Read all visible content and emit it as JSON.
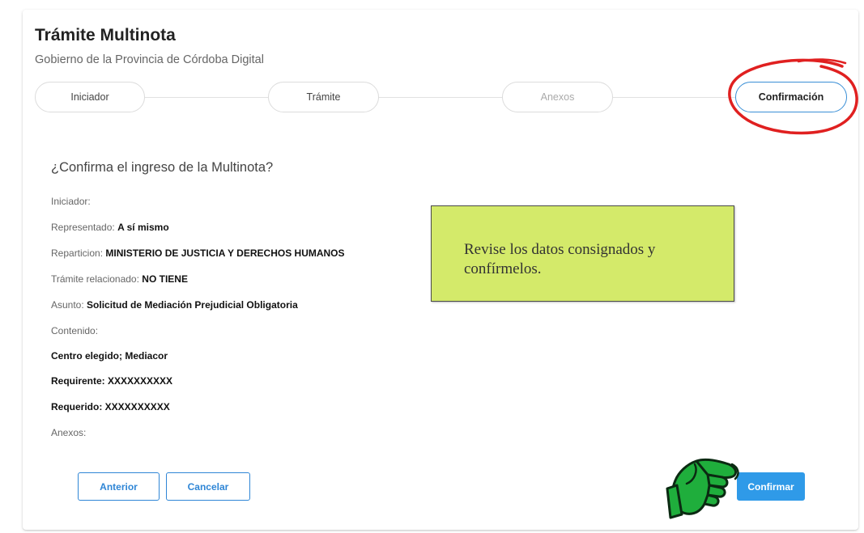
{
  "header": {
    "title": "Trámite Multinota",
    "subtitle": "Gobierno de la Provincia de Córdoba Digital"
  },
  "stepper": {
    "steps": [
      {
        "label": "Iniciador",
        "state": "done"
      },
      {
        "label": "Trámite",
        "state": "done"
      },
      {
        "label": "Anexos",
        "state": "inactive"
      },
      {
        "label": "Confirmación",
        "state": "active"
      }
    ]
  },
  "confirmation": {
    "question": "¿Confirma el ingreso de la Multinota?",
    "iniciador_label": "Iniciador:",
    "representado_label": "Representado:",
    "representado_value": "A sí mismo",
    "reparticion_label": "Reparticion:",
    "reparticion_value": "MINISTERIO DE JUSTICIA Y DERECHOS HUMANOS",
    "tramite_label": "Trámite relacionado:",
    "tramite_value": "NO TIENE",
    "asunto_label": "Asunto:",
    "asunto_value": "Solicitud de Mediación Prejudicial Obligatoria",
    "contenido_label": "Contenido:",
    "contenido_lines": [
      "Centro elegido; Mediacor",
      "Requirente: XXXXXXXXXX",
      "Requerido: XXXXXXXXXX"
    ],
    "anexos_label": "Anexos:"
  },
  "callout": {
    "text": "Revise los datos consignados y confírmelos.",
    "color": "#d4ea6a"
  },
  "buttons": {
    "anterior": "Anterior",
    "cancelar": "Cancelar",
    "confirmar": "Confirmar"
  },
  "colors": {
    "accent": "#2f86d6",
    "primary_button": "#2f9ae8",
    "highlight_circle": "#e02020",
    "pointer_hand": "#1fae3c"
  },
  "icons": {
    "pointer": "pointing-hand-icon",
    "highlight": "red-circle-annotation"
  }
}
